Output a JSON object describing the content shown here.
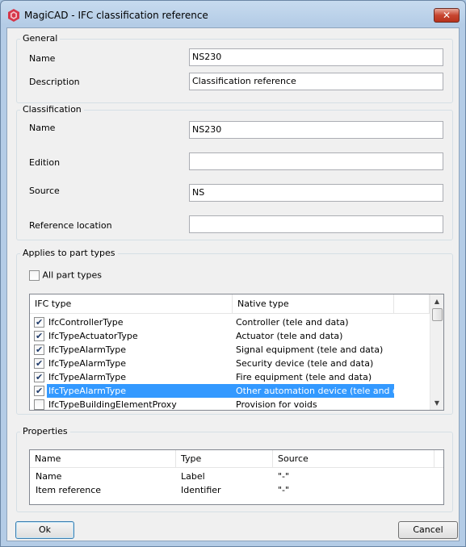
{
  "window": {
    "title": "MagiCAD - IFC classification reference",
    "close_glyph": "✕"
  },
  "general": {
    "group_label": "General",
    "name_label": "Name",
    "name_value": "NS230",
    "description_label": "Description",
    "description_value": "Classification reference"
  },
  "classification": {
    "group_label": "Classification",
    "name_label": "Name",
    "name_value": "NS230",
    "edition_label": "Edition",
    "edition_value": "",
    "source_label": "Source",
    "source_value": "NS",
    "reference_location_label": "Reference location",
    "reference_location_value": ""
  },
  "applies": {
    "group_label": "Applies to part types",
    "all_part_types_label": "All part types",
    "all_part_types_checked": false,
    "columns": [
      "IFC type",
      "Native type"
    ],
    "rows": [
      {
        "ifc": "IfcControllerType",
        "native": "Controller (tele and data)",
        "checked": true,
        "selected": false
      },
      {
        "ifc": "IfcTypeActuatorType",
        "native": "Actuator (tele and data)",
        "checked": true,
        "selected": false
      },
      {
        "ifc": "IfcTypeAlarmType",
        "native": "Signal equipment (tele and data)",
        "checked": true,
        "selected": false
      },
      {
        "ifc": "IfcTypeAlarmType",
        "native": "Security device (tele and data)",
        "checked": true,
        "selected": false
      },
      {
        "ifc": "IfcTypeAlarmType",
        "native": "Fire equipment (tele and data)",
        "checked": true,
        "selected": false
      },
      {
        "ifc": "IfcTypeAlarmType",
        "native": "Other automation device (tele and data)",
        "checked": true,
        "selected": true
      },
      {
        "ifc": "IfcTypeBuildingElementProxy",
        "native": "Provision for voids",
        "checked": false,
        "selected": false
      }
    ],
    "selection_color": "#3399ff"
  },
  "properties": {
    "group_label": "Properties",
    "columns": [
      "Name",
      "Type",
      "Source"
    ],
    "rows": [
      {
        "name": "Name",
        "type": "Label",
        "source": "\"-\""
      },
      {
        "name": "Item reference",
        "type": "Identifier",
        "source": "\"-\""
      }
    ]
  },
  "buttons": {
    "ok_label": "Ok",
    "cancel_label": "Cancel"
  }
}
